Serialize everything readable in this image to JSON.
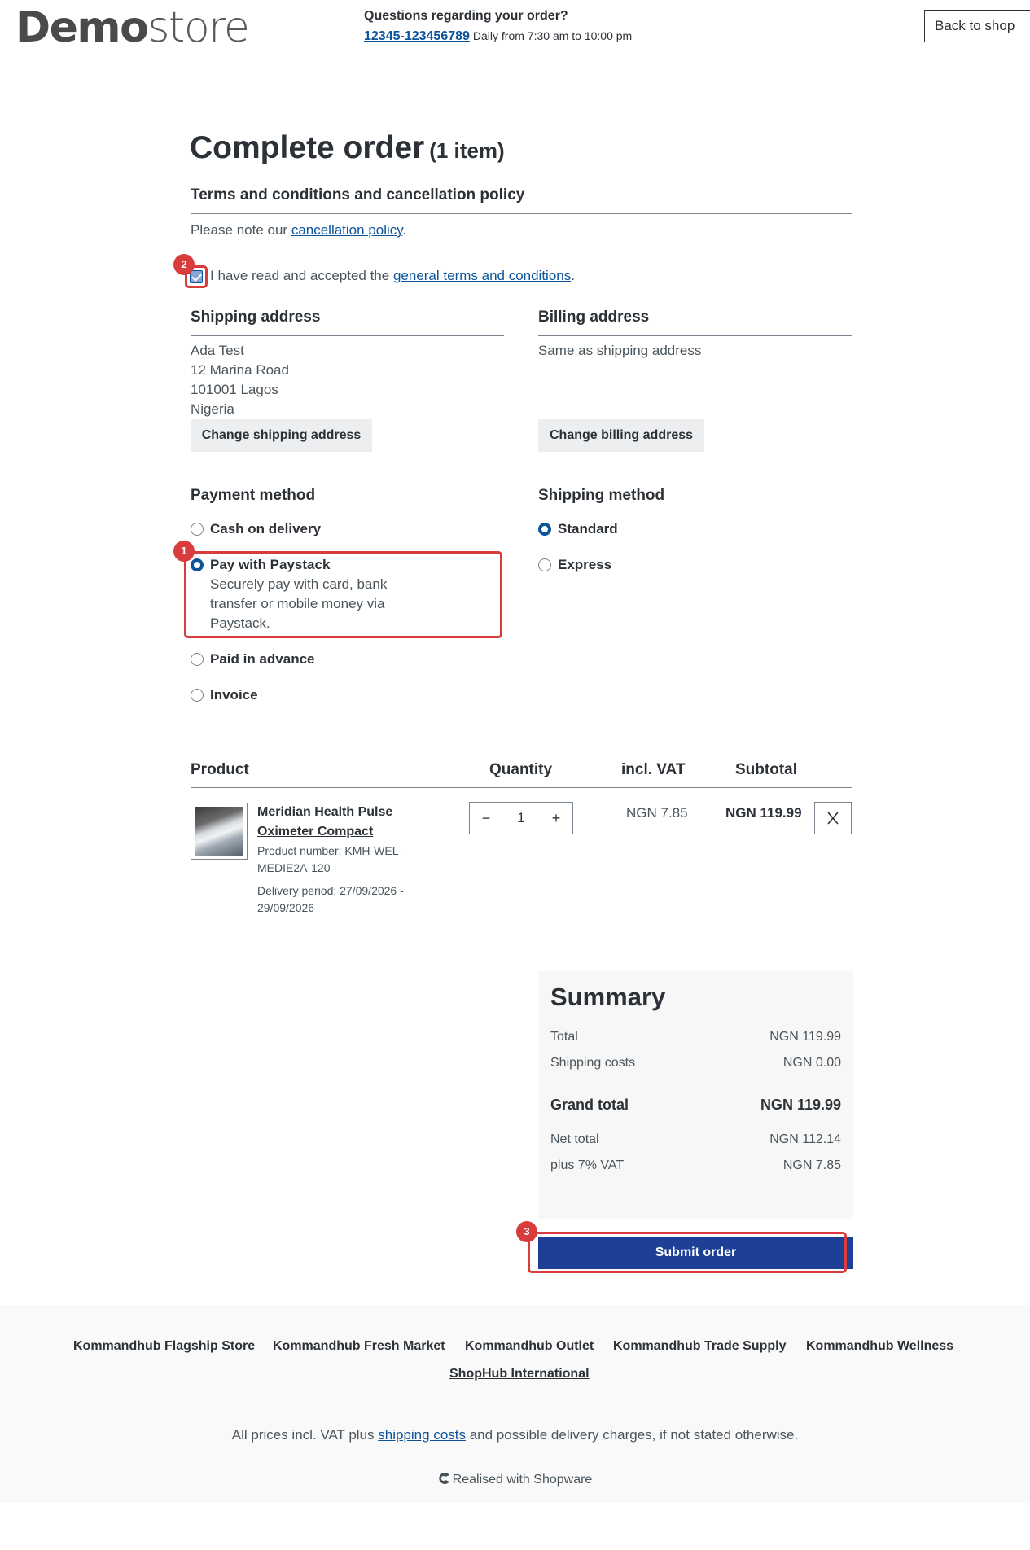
{
  "header": {
    "logo_bold": "Demo",
    "logo_light": "store",
    "help_question": "Questions regarding your order?",
    "help_phone": "12345-123456789",
    "help_hours": "Daily from 7:30 am to 10:00 pm",
    "back_button": "Back to shop"
  },
  "page": {
    "title": "Complete order",
    "item_count": "(1 item)"
  },
  "terms": {
    "heading": "Terms and conditions and cancellation policy",
    "note_prefix": "Please note our ",
    "note_link": "cancellation policy",
    "note_suffix": ".",
    "checkbox_prefix": "I have read and accepted the ",
    "checkbox_link": "general terms and conditions",
    "checkbox_suffix": ".",
    "checked": true
  },
  "shipping_address": {
    "heading": "Shipping address",
    "lines": [
      "Ada Test",
      "12 Marina Road",
      "101001 Lagos",
      "Nigeria"
    ],
    "button": "Change shipping address"
  },
  "billing_address": {
    "heading": "Billing address",
    "text": "Same as shipping address",
    "button": "Change billing address"
  },
  "payment": {
    "heading": "Payment method",
    "options": [
      {
        "label": "Cash on delivery",
        "selected": false
      },
      {
        "label": "Pay with Paystack",
        "description": "Securely pay with card, bank transfer or mobile money via Paystack.",
        "selected": true
      },
      {
        "label": "Paid in advance",
        "selected": false
      },
      {
        "label": "Invoice",
        "selected": false
      }
    ]
  },
  "shipping_method": {
    "heading": "Shipping method",
    "options": [
      {
        "label": "Standard",
        "selected": true
      },
      {
        "label": "Express",
        "selected": false
      }
    ]
  },
  "cart": {
    "headers": {
      "product": "Product",
      "quantity": "Quantity",
      "vat": "incl. VAT",
      "subtotal": "Subtotal"
    },
    "items": [
      {
        "name": "Meridian Health Pulse Oximeter Compact",
        "product_number": "Product number: KMH-WEL-MEDIE2A-120",
        "delivery": "Delivery period: 27/09/2026 - 29/09/2026",
        "quantity": "1",
        "vat": "NGN 7.85",
        "subtotal": "NGN 119.99"
      }
    ]
  },
  "summary": {
    "heading": "Summary",
    "total_label": "Total",
    "total_value": "NGN 119.99",
    "shipping_label": "Shipping costs",
    "shipping_value": "NGN 0.00",
    "grand_label": "Grand total",
    "grand_value": "NGN 119.99",
    "net_label": "Net total",
    "net_value": "NGN 112.14",
    "vat_label": "plus 7% VAT",
    "vat_value": "NGN 7.85"
  },
  "submit_button": "Submit order",
  "annotations": {
    "step1": "1",
    "step2": "2",
    "step3": "3",
    "highlight_color": "#d93c3c"
  },
  "footer": {
    "stores": [
      "Kommandhub Flagship Store",
      "Kommandhub Fresh Market",
      "Kommandhub Outlet",
      "Kommandhub Trade Supply",
      "Kommandhub Wellness",
      "ShopHub International"
    ],
    "note_prefix": "All prices incl. VAT plus ",
    "note_link": "shipping costs",
    "note_suffix": " and possible delivery charges, if not stated otherwise.",
    "realised": "Realised with Shopware"
  },
  "colors": {
    "accent": "#0b539b",
    "submit": "#1d3f96",
    "text": "#2b3136"
  }
}
